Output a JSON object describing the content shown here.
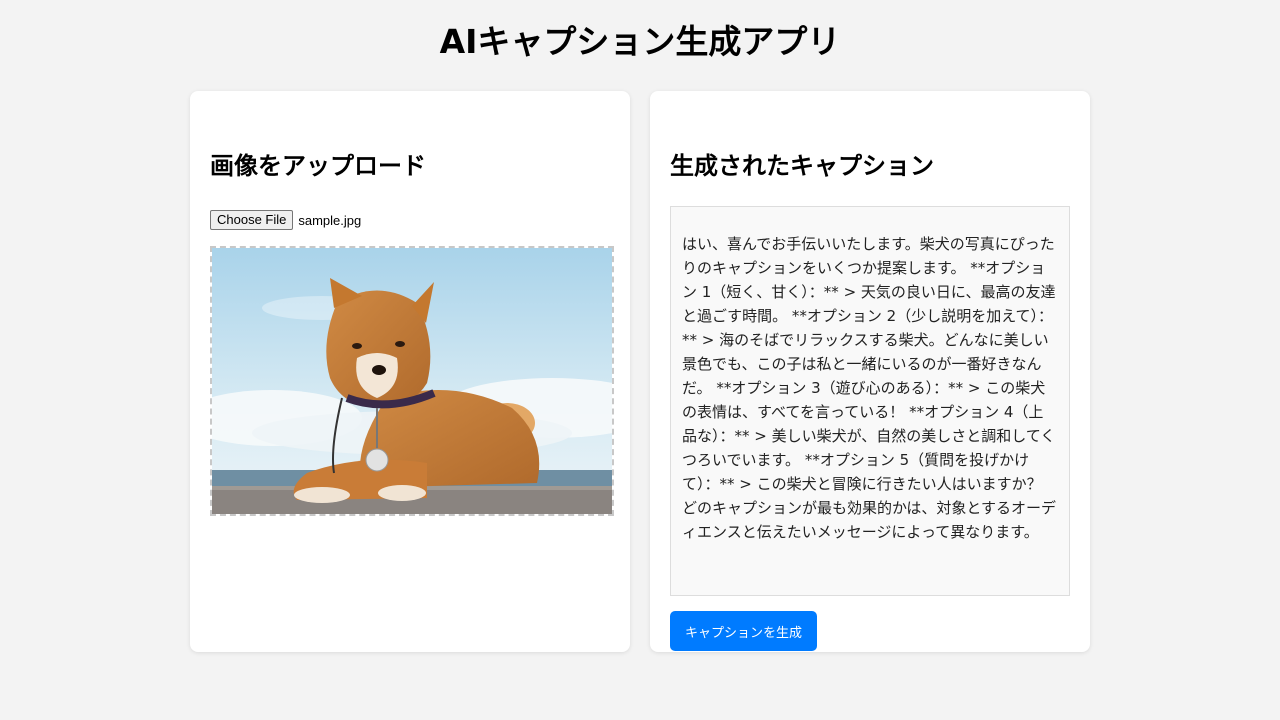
{
  "app": {
    "title": "AIキャプション生成アプリ"
  },
  "upload": {
    "heading": "画像をアップロード",
    "choose_file_label": "Choose File",
    "file_name": "sample.jpg"
  },
  "caption": {
    "heading": "生成されたキャプション",
    "text": "はい、喜んでお手伝いいたします。柴犬の写真にぴったりのキャプションをいくつか提案します。 **オプション 1（短く、甘く）：** > 天気の良い日に、最高の友達と過ごす時間。 **オプション 2（少し説明を加えて）：** > 海のそばでリラックスする柴犬。どんなに美しい景色でも、この子は私と一緒にいるのが一番好きなんだ。 **オプション 3（遊び心のある）：** > この柴犬の表情は、すべてを言っている！ **オプション 4（上品な）：** > 美しい柴犬が、自然の美しさと調和してくつろいでいます。 **オプション 5（質問を投げかけて）：** > この柴犬と冒険に行きたい人はいますか？ どのキャプションが最も効果的かは、対象とするオーディエンスと伝えたいメッセージによって異なります。",
    "generate_button": "キャプションを生成"
  },
  "colors": {
    "accent": "#007bff",
    "page_background": "#f3f3f3"
  }
}
